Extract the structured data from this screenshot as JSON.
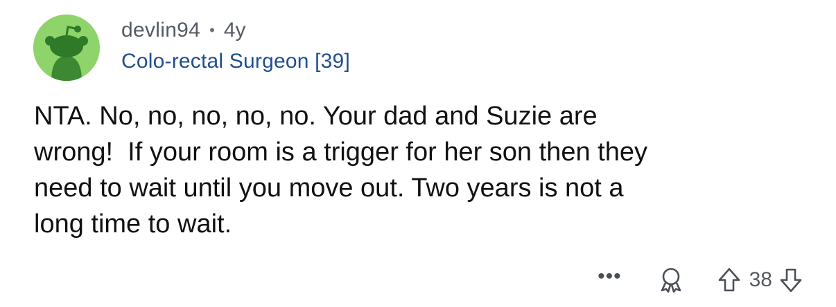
{
  "comment": {
    "username": "devlin94",
    "separator": "•",
    "age": "4y",
    "flair": "Colo-rectal Surgeon [39]",
    "body": "NTA. No, no, no, no, no. Your dad and Suzie are\nwrong!  If your room is a trigger for her son then they\nneed to wait until you move out. Two years is not a\nlong time to wait."
  },
  "actions": {
    "more_label": "•••",
    "score": "38",
    "icons": [
      "snoo-avatar-icon",
      "award-icon",
      "upvote-arrow-icon",
      "downvote-arrow-icon"
    ]
  },
  "colors": {
    "avatar_bg": "#8ed46a",
    "avatar_figure": "#2f7a28",
    "flair_text": "#1f4e8f",
    "meta_text": "#555b63",
    "body_text": "#111111"
  }
}
